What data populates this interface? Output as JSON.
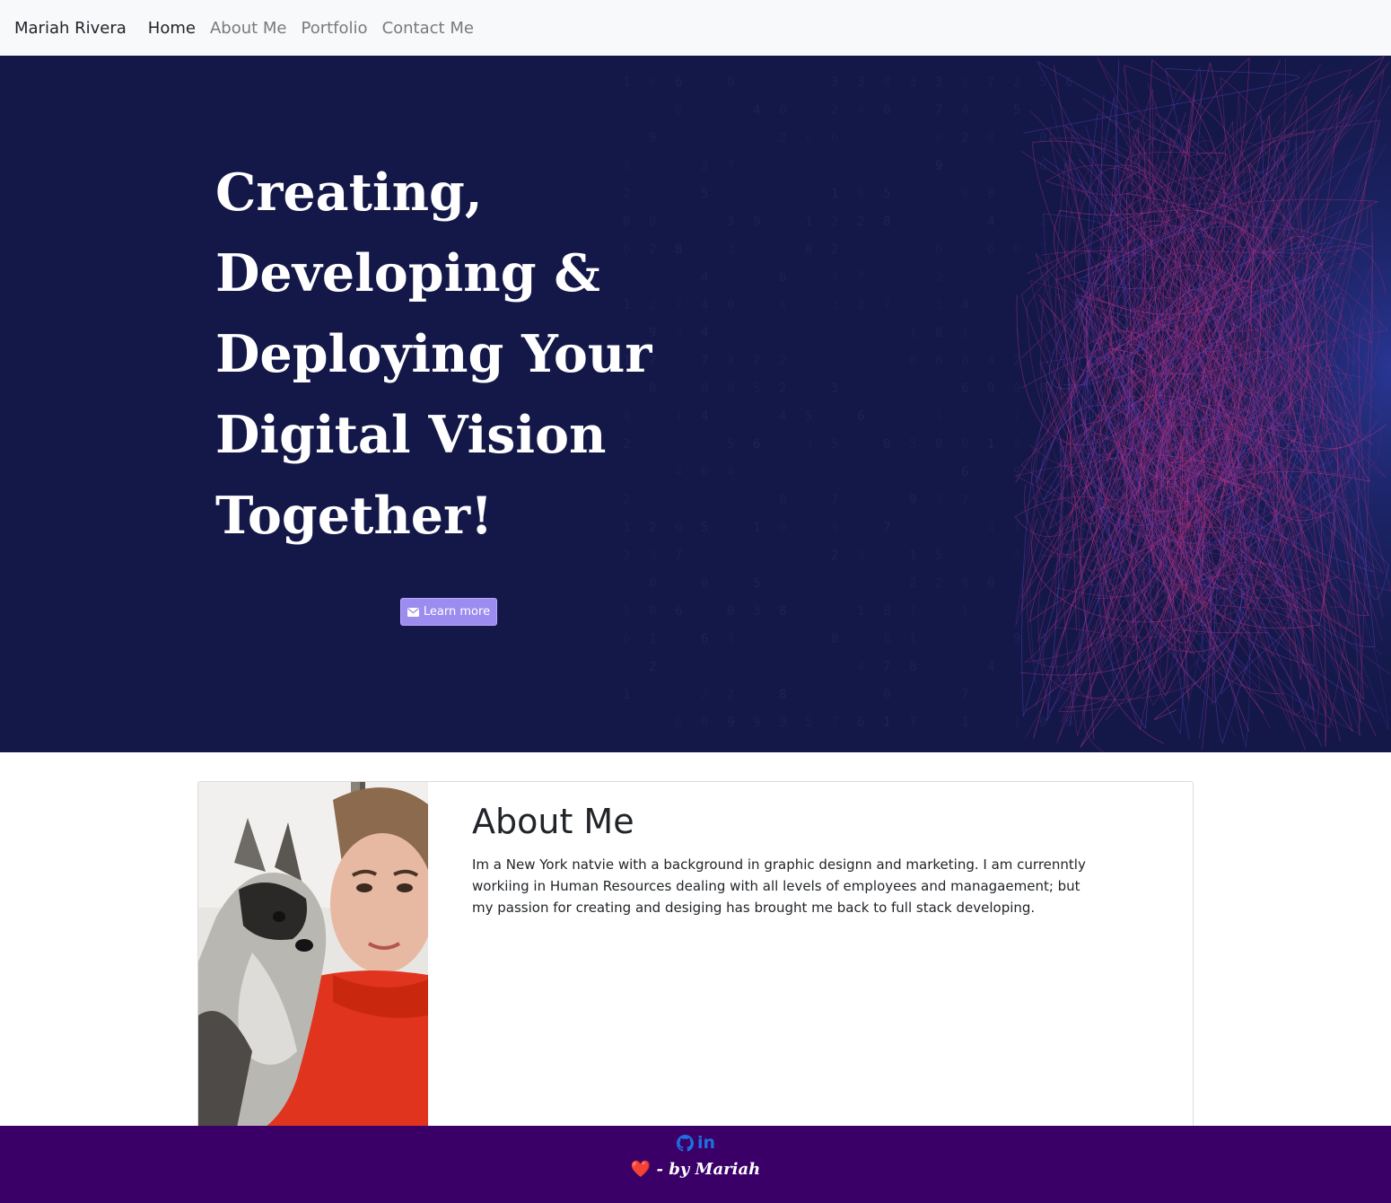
{
  "navbar": {
    "brand": "Mariah Rivera",
    "links": [
      {
        "label": "Home"
      },
      {
        "label": "About Me"
      },
      {
        "label": "Portfolio"
      },
      {
        "label": "Contact Me"
      }
    ]
  },
  "hero": {
    "title_lines": [
      "Creating,",
      "Developing &",
      "Deploying Your",
      "Digital Vision",
      "Together!"
    ],
    "button_label": "Learn more",
    "button_icon": "envelope-icon"
  },
  "about": {
    "heading": "About Me",
    "body": "Im a New York natvie with a background in graphic designn and marketing. I am currenntly workiing in Human Resources dealing with all levels of employees and managaement; but my passion for creating and desiging has brought me back to full stack developing.",
    "photo_icon": "profile-photo"
  },
  "footer": {
    "icons": [
      "github-icon",
      "linkedin-icon"
    ],
    "linkedin_glyph": "in",
    "heart": "❤️",
    "signature": " - by Mariah"
  },
  "colors": {
    "hero_bg": "#141849",
    "footer_bg": "#3a0068",
    "accent_button": "#9c8cf0",
    "link_blue": "#1f6fe0"
  }
}
